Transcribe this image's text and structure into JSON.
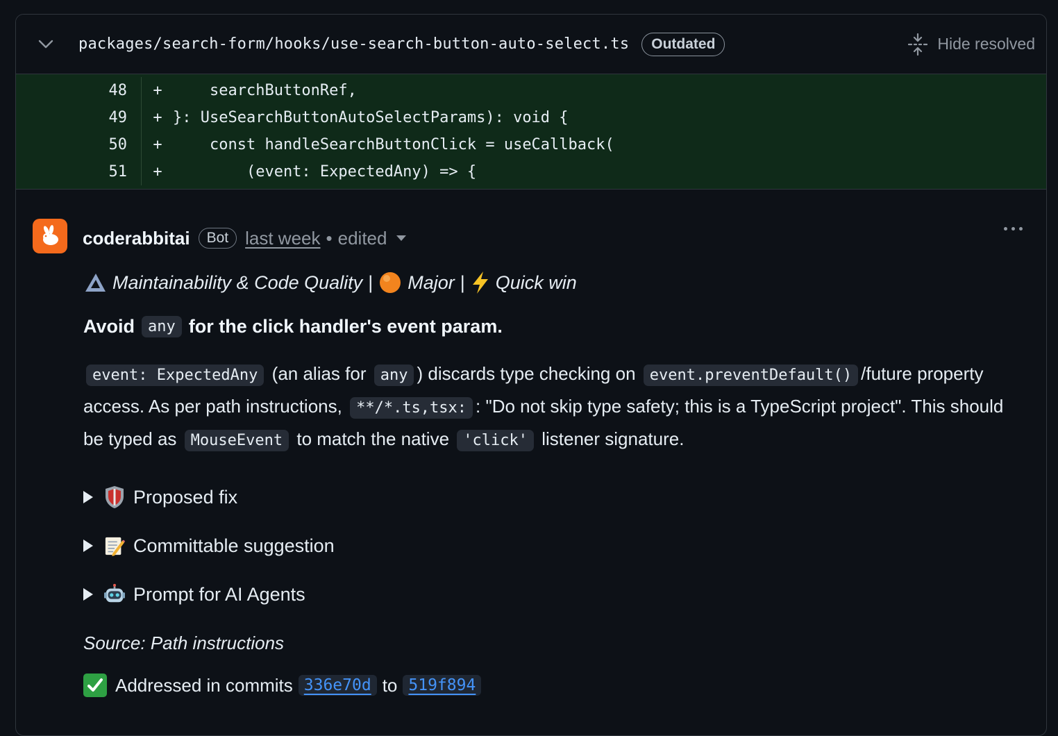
{
  "file": {
    "path": "packages/search-form/hooks/use-search-button-auto-select.ts",
    "badge": "Outdated",
    "hide_resolved": "Hide resolved"
  },
  "diff": [
    {
      "line": "48",
      "sign": "+",
      "code": "    searchButtonRef,"
    },
    {
      "line": "49",
      "sign": "+",
      "code": "}: UseSearchButtonAutoSelectParams): void {"
    },
    {
      "line": "50",
      "sign": "+",
      "code": "    const handleSearchButtonClick = useCallback("
    },
    {
      "line": "51",
      "sign": "+",
      "code": "        (event: ExpectedAny) => {"
    }
  ],
  "comment": {
    "author": "coderabbitai",
    "bot_badge": "Bot",
    "time": "last week",
    "dot": "•",
    "edited": "edited",
    "tags": {
      "category": "Maintainability & Code Quality",
      "sep1": "|",
      "severity": "Major",
      "sep2": "|",
      "effort": "Quick win"
    },
    "headline": {
      "pre": "Avoid",
      "code": "any",
      "post": "for the click handler's event param."
    },
    "para": {
      "c1": "event: ExpectedAny",
      "t1": "(an alias for",
      "c2": "any",
      "t2": ") discards type checking on",
      "c3": "event.preventDefault()",
      "t3": "/future property access. As per path instructions,",
      "c4": "**/*.ts,tsx:",
      "t4": ": \"Do not skip type safety; this is a TypeScript project\". This should be typed as",
      "c5": "MouseEvent",
      "t5": "to match the native",
      "c6": "'click'",
      "t6": "listener signature."
    },
    "details": [
      {
        "label": "Proposed fix",
        "icon": "shield-icon"
      },
      {
        "label": "Committable suggestion",
        "icon": "memo-icon"
      },
      {
        "label": "Prompt for AI Agents",
        "icon": "robot-icon"
      }
    ],
    "source": "Source: Path instructions",
    "addressed": {
      "text": "Addressed in commits",
      "from": "336e70d",
      "to_word": "to",
      "to": "519f894"
    }
  },
  "colors": {
    "accent_orange": "#f46a1c",
    "link_blue": "#4493f8",
    "diff_added_bg": "#0f2a19",
    "check_green": "#2ea043"
  }
}
